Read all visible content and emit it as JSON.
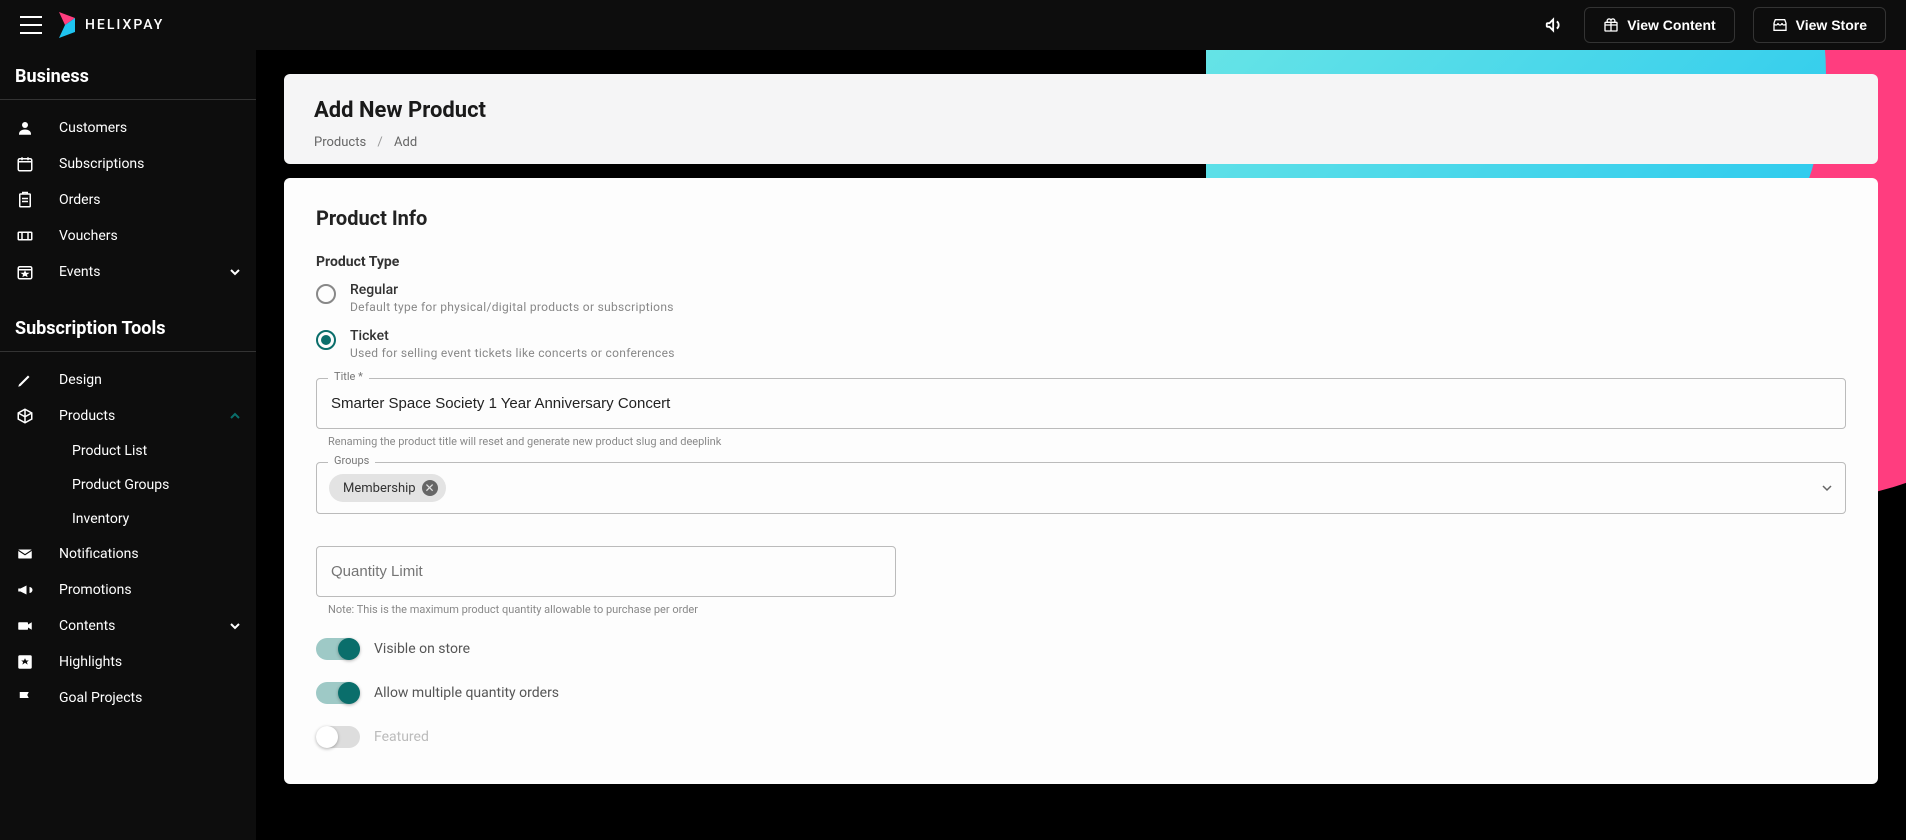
{
  "brand": {
    "name": "HELIXPAY"
  },
  "topbar": {
    "view_content": "View Content",
    "view_store": "View Store"
  },
  "sidebar": {
    "section1": "Business",
    "items1": [
      {
        "label": "Customers"
      },
      {
        "label": "Subscriptions"
      },
      {
        "label": "Orders"
      },
      {
        "label": "Vouchers"
      },
      {
        "label": "Events",
        "expandable": true
      }
    ],
    "section2": "Subscription Tools",
    "items2": [
      {
        "label": "Design"
      },
      {
        "label": "Products",
        "expandable": true,
        "expanded": true
      },
      {
        "label": "Notifications"
      },
      {
        "label": "Promotions"
      },
      {
        "label": "Contents",
        "expandable": true
      },
      {
        "label": "Highlights"
      },
      {
        "label": "Goal Projects"
      }
    ],
    "products_sub": [
      {
        "label": "Product List"
      },
      {
        "label": "Product Groups"
      },
      {
        "label": "Inventory"
      }
    ]
  },
  "page": {
    "title": "Add New Product",
    "breadcrumb": {
      "root": "Products",
      "current": "Add"
    }
  },
  "form": {
    "section_title": "Product Info",
    "product_type_label": "Product Type",
    "radios": {
      "regular": {
        "label": "Regular",
        "desc": "Default type for physical/digital products or subscriptions",
        "selected": false
      },
      "ticket": {
        "label": "Ticket",
        "desc": "Used for selling event tickets like concerts or conferences",
        "selected": true
      }
    },
    "title_field": {
      "label": "Title *",
      "value": "Smarter Space Society 1 Year Anniversary Concert",
      "helper": "Renaming the product title will reset and generate new product slug and deeplink"
    },
    "groups": {
      "label": "Groups",
      "chips": [
        "Membership"
      ]
    },
    "qty": {
      "placeholder": "Quantity Limit",
      "helper": "Note: This is the maximum product quantity allowable to purchase per order"
    },
    "toggles": {
      "visible": {
        "label": "Visible on store",
        "on": true
      },
      "multiple": {
        "label": "Allow multiple quantity orders",
        "on": true
      },
      "featured": {
        "label": "Featured",
        "on": false
      }
    }
  }
}
